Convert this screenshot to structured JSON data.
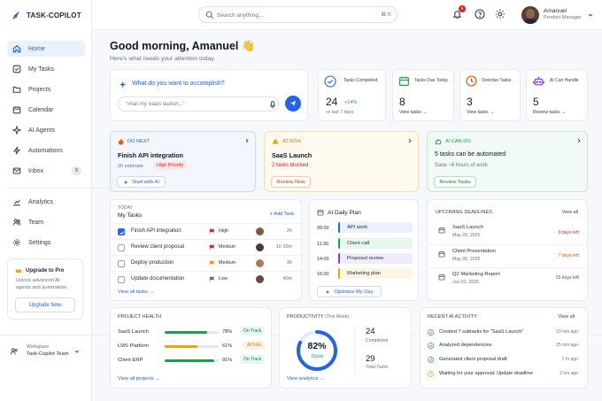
{
  "app": {
    "name": "TASK-COPILOT"
  },
  "header": {
    "search_placeholder": "Search anything...",
    "search_shortcut": "⌘ K",
    "notifications_count": "8",
    "user_name": "Amanuel",
    "user_role": "Product Manager"
  },
  "sidebar": {
    "items": [
      {
        "label": "Home"
      },
      {
        "label": "My Tasks"
      },
      {
        "label": "Projects"
      },
      {
        "label": "Calendar"
      },
      {
        "label": "AI Agents"
      },
      {
        "label": "Automations"
      },
      {
        "label": "Inbox",
        "badge": "8"
      },
      {
        "label": "Analytics"
      },
      {
        "label": "Team"
      },
      {
        "label": "Settings"
      }
    ],
    "upgrade": {
      "title": "Upgrade to Pro",
      "text1": "Unlock advanced AI",
      "text2": "agents and automation.",
      "button": "Upgrade Now"
    },
    "workspace": {
      "label": "Workspace",
      "name": "Task-Copilot Team"
    }
  },
  "greeting": {
    "title": "Good morning, Amanuel 👋",
    "subtitle": "Here's what needs your attention today."
  },
  "ask": {
    "title": "What do you want to accomplish?",
    "placeholder": "\"Plan my SaaS launch...\""
  },
  "stats": [
    {
      "label": "Tasks Completed",
      "value": "24",
      "delta": "+14%",
      "sub": "vs last 7 days",
      "color": "#2563eb"
    },
    {
      "label": "Tasks Due Today",
      "value": "8",
      "sub": "View tasks →",
      "color": "#16a34a"
    },
    {
      "label": "Overdue Tasks",
      "value": "3",
      "sub": "View tasks →",
      "color": "#ea580c"
    },
    {
      "label": "AI Can Handle",
      "value": "5",
      "sub": "Review tasks →",
      "color": "#7c3aed"
    }
  ],
  "focus": [
    {
      "tag": "DO NEXT",
      "title": "Finish API integration",
      "meta": "2h estimate",
      "badge": "High Priority",
      "button": "Start with AI"
    },
    {
      "tag": "AT RISK",
      "title": "SaaS Launch",
      "meta": "2 tasks blocked",
      "button": "Review Now"
    },
    {
      "tag": "AI CAN DO",
      "title": "5 tasks can be automated",
      "meta": "Save ~6 hours of work",
      "button": "Review Tasks"
    }
  ],
  "tasks": {
    "section": "TODAY",
    "title": "My Tasks",
    "add": "+ Add Task",
    "view_all": "View all tasks →",
    "items": [
      {
        "name": "Finish API integration",
        "priority": "High",
        "due": "2h",
        "done": true,
        "flag": "#dc2626"
      },
      {
        "name": "Review client proposal",
        "priority": "Medium",
        "due": "1h 30m",
        "done": false,
        "flag": "#dc2626"
      },
      {
        "name": "Deploy production",
        "priority": "Medium",
        "due": "3h",
        "done": false,
        "flag": "#f59e0b"
      },
      {
        "name": "Update documentation",
        "priority": "Low",
        "due": "40m",
        "done": false,
        "flag": "#6b7280"
      }
    ]
  },
  "plan": {
    "title": "AI Daily Plan",
    "button": "Optimize My Day",
    "items": [
      {
        "time": "09:00",
        "label": "API work",
        "color": "#eaf1fe",
        "bar": "#2563eb"
      },
      {
        "time": "11:30",
        "label": "Client call",
        "color": "#e8f7ee",
        "bar": "#16a34a"
      },
      {
        "time": "14:00",
        "label": "Proposal review",
        "color": "#f1ecfd",
        "bar": "#7c3aed"
      },
      {
        "time": "16:00",
        "label": "Marketing plan",
        "color": "#fdf5e4",
        "bar": "#f59e0b"
      }
    ]
  },
  "deadlines": {
    "title": "UPCOMING DEADLINES",
    "view_all": "View all",
    "items": [
      {
        "name": "SaaS Launch",
        "date": "May 28, 2025",
        "left": "3 days left",
        "color": "#dc2626"
      },
      {
        "name": "Client Presentation",
        "date": "May 30, 2025",
        "left": "7 days left",
        "color": "#ea580c"
      },
      {
        "name": "Q2 Marketing Report",
        "date": "Jun 02, 2025",
        "left": "15 days left",
        "color": "#4b5563"
      }
    ]
  },
  "health": {
    "title": "PROJECT HEALTH",
    "view_all": "View all projects →",
    "items": [
      {
        "name": "SaaS Launch",
        "pct": "78%",
        "value": 0.78,
        "status": "On Track",
        "color": "#16a34a"
      },
      {
        "name": "LMS Platform",
        "pct": "61%",
        "value": 0.61,
        "status": "At Risk",
        "color": "#f59e0b"
      },
      {
        "name": "Client ERP",
        "pct": "91%",
        "value": 0.91,
        "status": "On Track",
        "color": "#16a34a"
      }
    ]
  },
  "productivity": {
    "title": "PRODUCTIVITY",
    "period": "(This Week)",
    "score": "82%",
    "score_value": 0.82,
    "score_label": "Good",
    "completed": "24",
    "completed_label": "Completed",
    "total": "29",
    "total_label": "Total Tasks",
    "link": "View analytics →"
  },
  "activity": {
    "title": "RECENT AI ACTIVITY",
    "view_all": "View all",
    "items": [
      {
        "text": "Created 7 subtasks for \"SaaS Launch\"",
        "time": "10 min ago",
        "color": "#16a34a"
      },
      {
        "text": "Analyzed dependencies",
        "time": "25 min ago",
        "color": "#16a34a"
      },
      {
        "text": "Generated client proposal draft",
        "time": "1 hr ago",
        "color": "#16a34a"
      },
      {
        "text": "Waiting for your approval: Update deadline",
        "time": "2 hrs ago",
        "color": "#f59e0b"
      }
    ]
  }
}
